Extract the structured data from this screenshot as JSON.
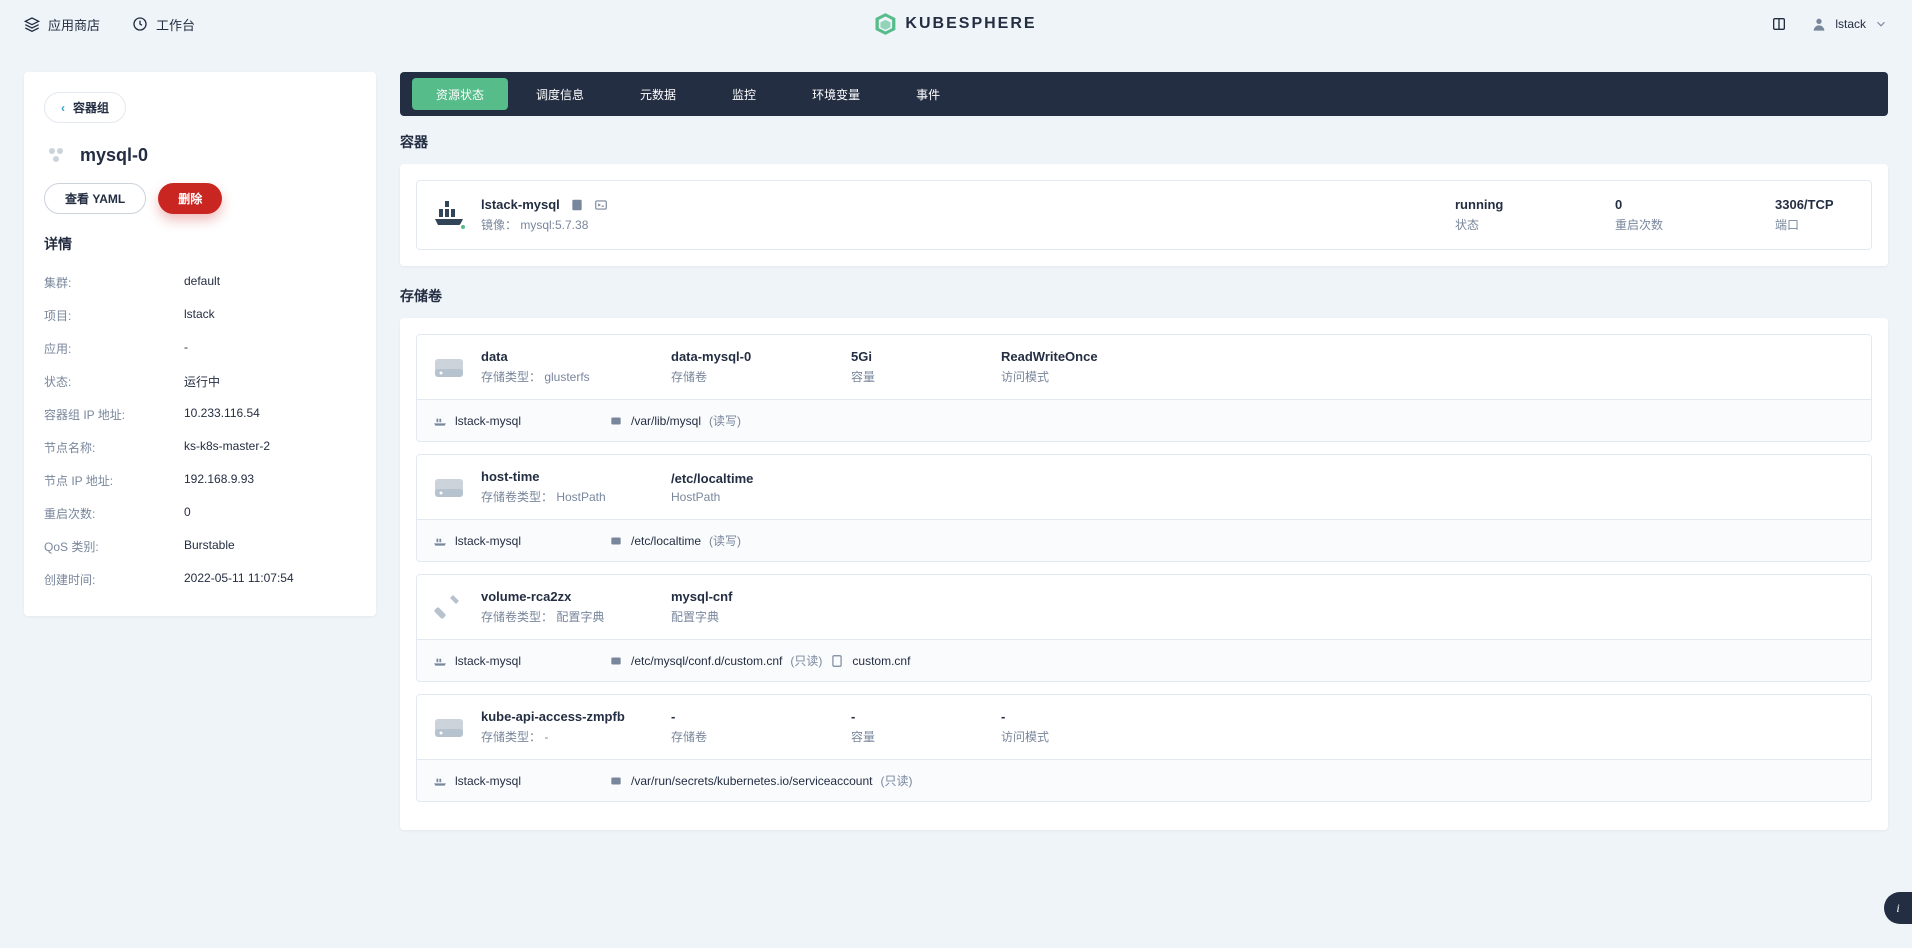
{
  "header": {
    "app_store": "应用商店",
    "workbench": "工作台",
    "brand": "KUBESPHERE",
    "user": "lstack"
  },
  "sidebar": {
    "back_label": "容器组",
    "pod_name": "mysql-0",
    "actions": {
      "view_yaml": "查看 YAML",
      "delete": "删除"
    },
    "details_title": "详情",
    "details": [
      {
        "label": "集群:",
        "value": "default"
      },
      {
        "label": "项目:",
        "value": "lstack"
      },
      {
        "label": "应用:",
        "value": "-"
      },
      {
        "label": "状态:",
        "value": "运行中"
      },
      {
        "label": "容器组 IP 地址:",
        "value": "10.233.116.54"
      },
      {
        "label": "节点名称:",
        "value": "ks-k8s-master-2"
      },
      {
        "label": "节点 IP 地址:",
        "value": "192.168.9.93"
      },
      {
        "label": "重启次数:",
        "value": "0"
      },
      {
        "label": "QoS 类别:",
        "value": "Burstable"
      },
      {
        "label": "创建时间:",
        "value": "2022-05-11 11:07:54"
      }
    ]
  },
  "tabs": [
    "资源状态",
    "调度信息",
    "元数据",
    "监控",
    "环境变量",
    "事件"
  ],
  "containers": {
    "title": "容器",
    "image_label": "镜像：",
    "items": [
      {
        "name": "lstack-mysql",
        "image": "mysql:5.7.38",
        "status": "running",
        "status_label": "状态",
        "restart": "0",
        "restart_label": "重启次数",
        "port": "3306/TCP",
        "port_label": "端口"
      }
    ]
  },
  "volumes": {
    "title": "存储卷",
    "items": [
      {
        "name": "data",
        "type_label": "存储类型：",
        "type": "glusterfs",
        "pvc": "data-mysql-0",
        "pvc_label": "存储卷",
        "capacity": "5Gi",
        "capacity_label": "容量",
        "access_mode": "ReadWriteOnce",
        "access_mode_label": "访问模式",
        "mount_container": "lstack-mysql",
        "mount_path": "/var/lib/mysql",
        "mount_access": "(读写)",
        "icon": "disk"
      },
      {
        "name": "host-time",
        "type_label": "存储卷类型：",
        "type": "HostPath",
        "pvc": "/etc/localtime",
        "pvc_label": "HostPath",
        "capacity": "",
        "capacity_label": "",
        "access_mode": "",
        "access_mode_label": "",
        "mount_container": "lstack-mysql",
        "mount_path": "/etc/localtime",
        "mount_access": "(读写)",
        "icon": "disk"
      },
      {
        "name": "volume-rca2zx",
        "type_label": "存储卷类型：",
        "type": "配置字典",
        "pvc": "mysql-cnf",
        "pvc_label": "配置字典",
        "capacity": "",
        "capacity_label": "",
        "access_mode": "",
        "access_mode_label": "",
        "mount_container": "lstack-mysql",
        "mount_path": "/etc/mysql/conf.d/custom.cnf",
        "mount_access": "(只读)",
        "mount_subpath": "custom.cnf",
        "icon": "hammer"
      },
      {
        "name": "kube-api-access-zmpfb",
        "type_label": "存储类型：",
        "type": "-",
        "pvc": "-",
        "pvc_label": "存储卷",
        "capacity": "-",
        "capacity_label": "容量",
        "access_mode": "-",
        "access_mode_label": "访问模式",
        "mount_container": "lstack-mysql",
        "mount_path": "/var/run/secrets/kubernetes.io/serviceaccount",
        "mount_access": "(只读)",
        "icon": "disk"
      }
    ]
  }
}
